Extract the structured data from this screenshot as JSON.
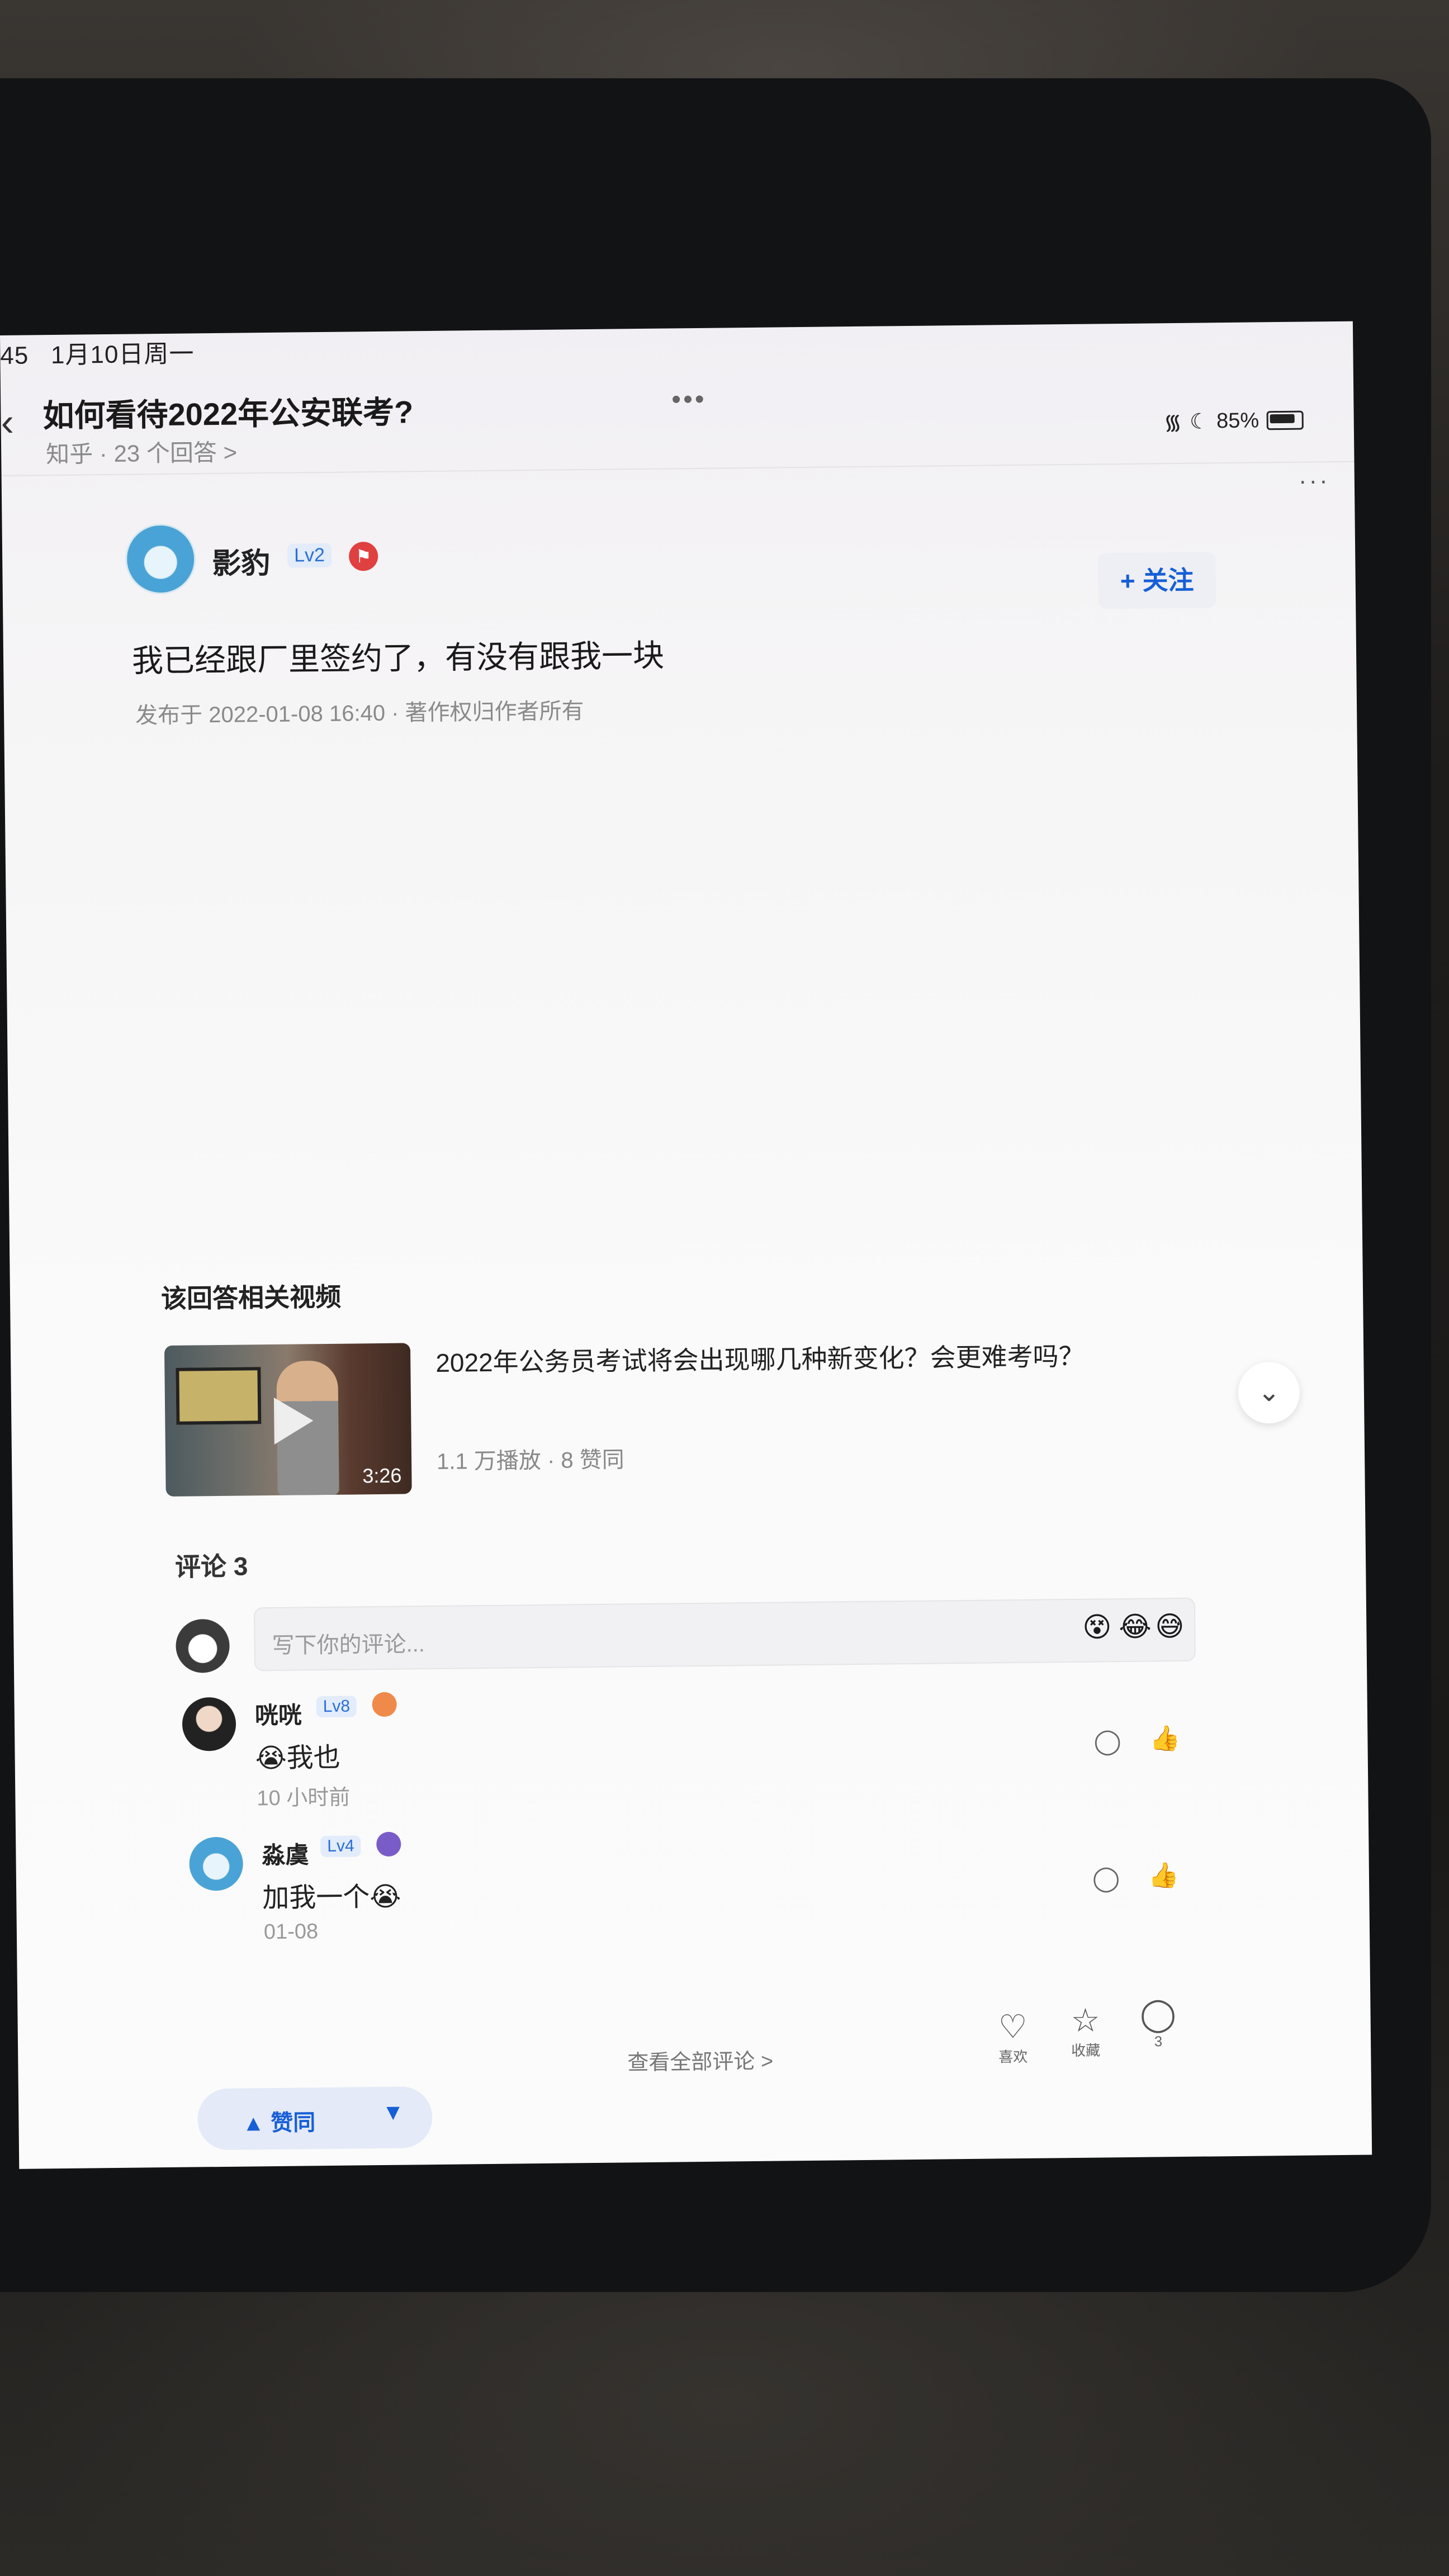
{
  "status": {
    "time": "45",
    "date": "1月10日周一",
    "battery": "85%"
  },
  "header": {
    "title": "如何看待2022年公安联考?",
    "subtitle": "知乎 · 23 个回答 >"
  },
  "author": {
    "name": "影豹",
    "level": "Lv2",
    "follow": "+ 关注"
  },
  "answer": {
    "content": "我已经跟厂里签约了，有没有跟我一块",
    "meta": "发布于 2022-01-08 16:40 · 著作权归作者所有"
  },
  "related": {
    "section_title": "该回答相关视频",
    "video_title": "2022年公务员考试将会出现哪几种新变化？会更难考吗？",
    "duration": "3:26",
    "stats": "1.1 万播放 · 8 赞同"
  },
  "comments": {
    "title": "评论 3",
    "placeholder": "写下你的评论...",
    "items": [
      {
        "name": "咣咣",
        "level": "Lv8",
        "text": "😭我也",
        "time": "10 小时前"
      },
      {
        "name": "淼虞",
        "level": "Lv4",
        "text": "加我一个😭",
        "time": "01-08"
      }
    ],
    "view_all": "查看全部评论 >"
  },
  "bottom": {
    "like_label": "喜欢",
    "fav_label": "收藏",
    "comment_count": "3",
    "vote_label": "赞同"
  },
  "icons": [
    "back-icon",
    "wifi-icon",
    "moon-icon",
    "battery-icon",
    "more-icon",
    "play-icon",
    "double-chevron-down-icon",
    "reply-icon",
    "thumb-up-icon",
    "heart-icon",
    "star-icon",
    "comment-icon",
    "arrow-up-icon",
    "arrow-down-icon"
  ]
}
